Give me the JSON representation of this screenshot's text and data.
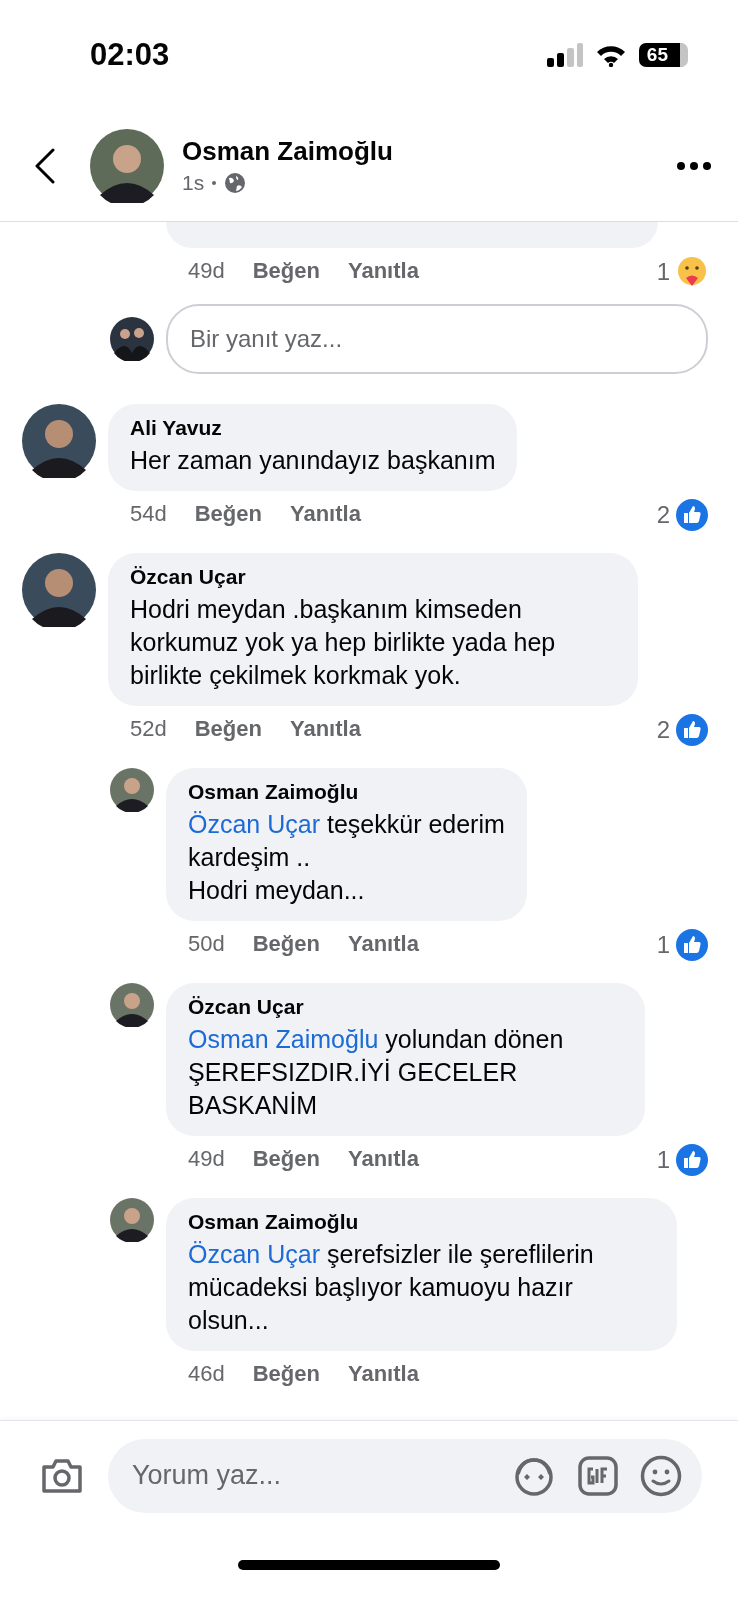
{
  "status_bar": {
    "time": "02:03",
    "battery": "65"
  },
  "header": {
    "name": "Osman Zaimoğlu",
    "time": "1s"
  },
  "items": [
    {
      "kind": "stub",
      "time": "49d",
      "like": "Beğen",
      "reply": "Yanıtla",
      "reaction": {
        "kind": "care",
        "count": "1"
      }
    },
    {
      "kind": "composer",
      "placeholder": "Bir yanıt yaz..."
    },
    {
      "kind": "comment",
      "name": "Ali Yavuz",
      "text": "Her zaman yanındayız başkanım",
      "time": "54d",
      "like": "Beğen",
      "reply": "Yanıtla",
      "reaction": {
        "kind": "like",
        "count": "2"
      }
    },
    {
      "kind": "comment",
      "name": "Özcan Uçar",
      "text": "Hodri meydan .başkanım kimseden korkumuz yok ya hep birlikte yada hep birlikte çekilmek korkmak yok.",
      "time": "52d",
      "like": "Beğen",
      "reply": "Yanıtla",
      "reaction": {
        "kind": "like",
        "count": "2"
      }
    },
    {
      "kind": "reply",
      "name": "Osman Zaimoğlu",
      "mention": "Özcan Uçar",
      "text": "teşekkür ederim\nkardeşim ..\nHodri meydan...",
      "time": "50d",
      "like": "Beğen",
      "reply": "Yanıtla",
      "reaction": {
        "kind": "like",
        "count": "1"
      }
    },
    {
      "kind": "reply",
      "name": "Özcan Uçar",
      "mention": "Osman Zaimoğlu",
      "text": "yolundan dönen ŞEREFSIZDIR.İYİ GECELER BASKANİM",
      "time": "49d",
      "like": "Beğen",
      "reply": "Yanıtla",
      "reaction": {
        "kind": "like",
        "count": "1"
      }
    },
    {
      "kind": "reply",
      "name": "Osman Zaimoğlu",
      "mention": "Özcan Uçar",
      "text": "şerefsizler ile şereflilerin mücadeksi başlıyor kamuoyu hazır olsun...",
      "time": "46d",
      "like": "Beğen",
      "reply": "Yanıtla"
    }
  ],
  "footer": {
    "placeholder": "Yorum yaz..."
  }
}
